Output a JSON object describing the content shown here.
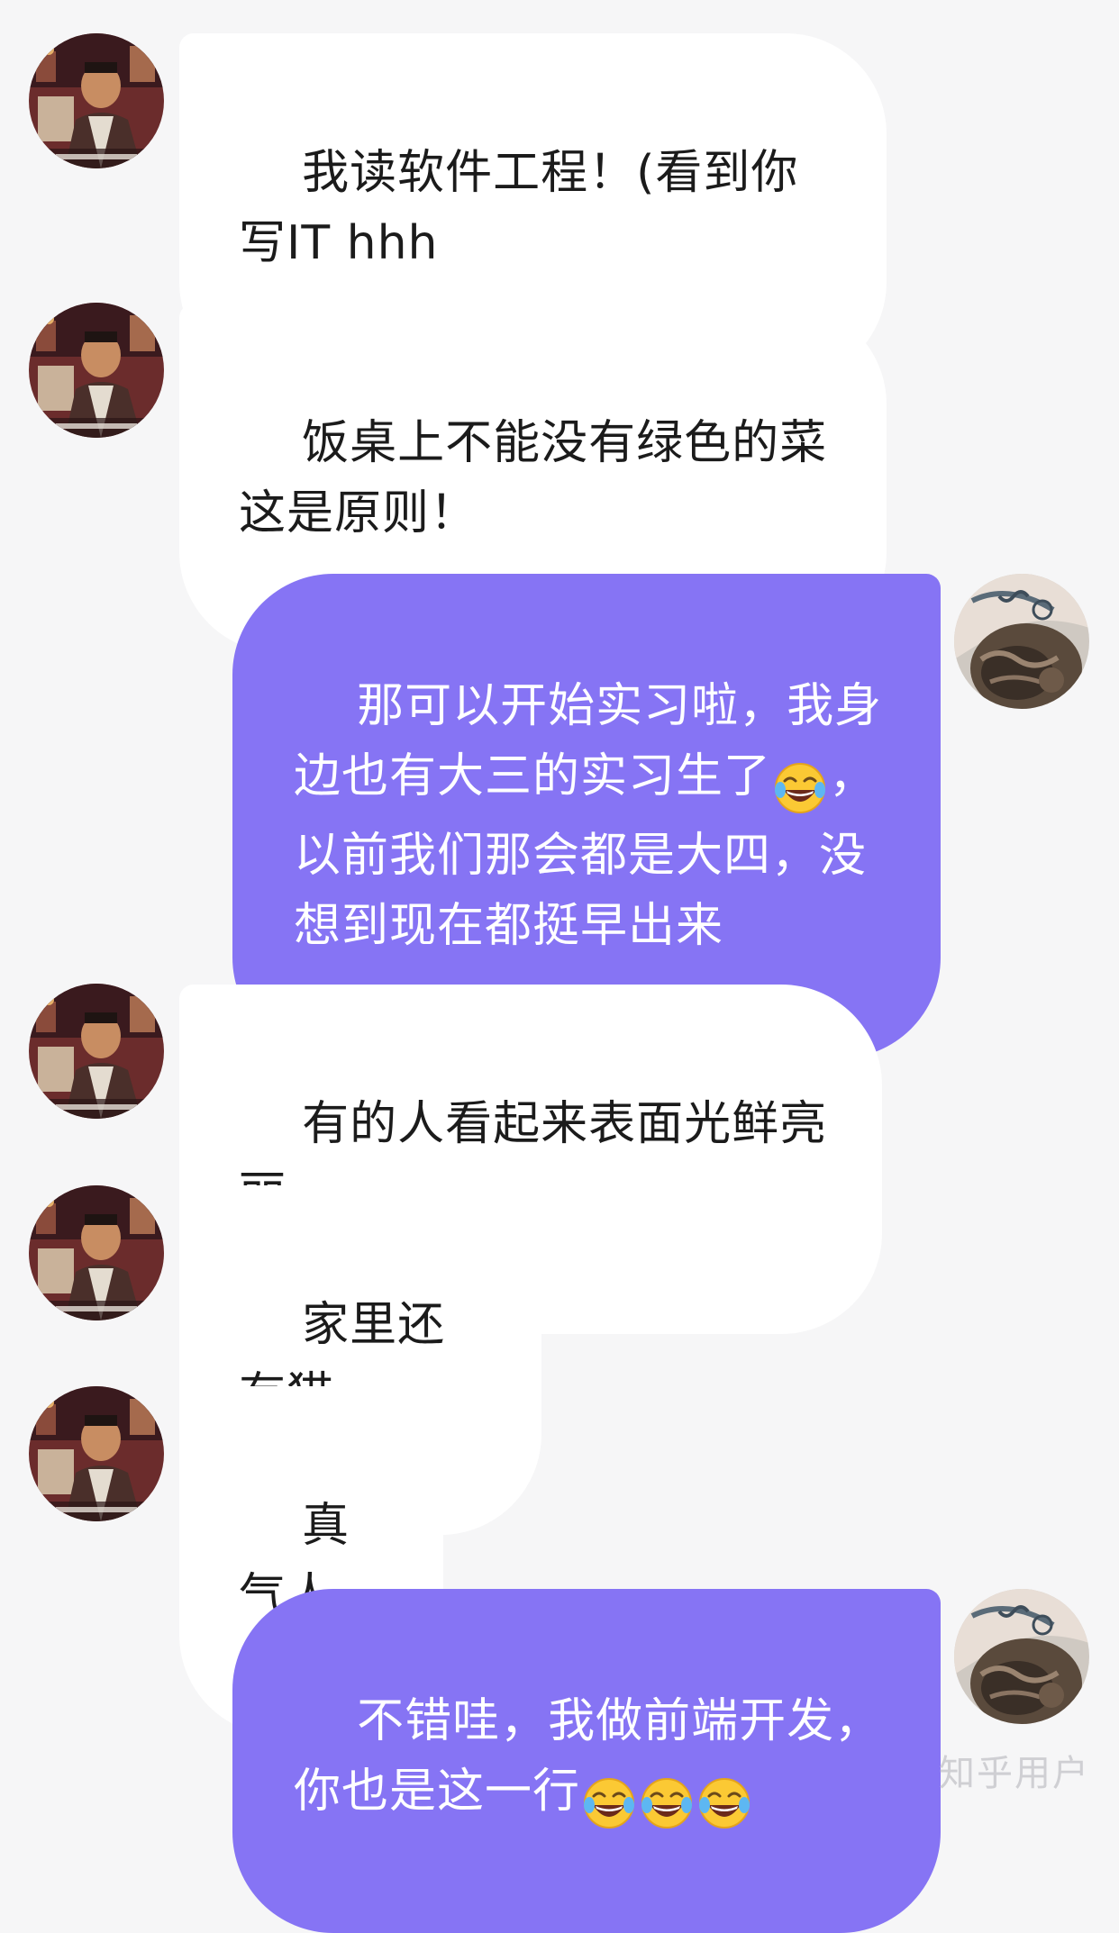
{
  "messages": [
    {
      "sender": "other",
      "avatar_icon": "avatar-other-icon",
      "text": "我读软件工程！(看到你写IT hhh"
    },
    {
      "sender": "other",
      "avatar_icon": "avatar-other-icon",
      "text": "饭桌上不能没有绿色的菜 这是原则！"
    },
    {
      "sender": "me",
      "avatar_icon": "avatar-me-icon",
      "text_before": "那可以开始实习啦，我身边也有大三的实习生了",
      "emoji_count": 1,
      "emoji_icon": "tears-of-joy-emoji-icon",
      "text_after": "，以前我们那会都是大四，没想到现在都挺早出来"
    },
    {
      "sender": "other",
      "avatar_icon": "avatar-other-icon",
      "text": "有的人看起来表面光鲜亮丽"
    },
    {
      "sender": "other",
      "avatar_icon": "avatar-other-icon",
      "text": "家里还有猫"
    },
    {
      "sender": "other",
      "avatar_icon": "avatar-other-icon",
      "text": "真气人"
    },
    {
      "sender": "me",
      "avatar_icon": "avatar-me-icon",
      "text_before": "不错哇，我做前端开发，你也是这一行",
      "emoji_count": 3,
      "emoji_icon": "tears-of-joy-emoji-icon",
      "text_after": ""
    }
  ],
  "watermark": "知乎用户",
  "colors": {
    "background": "#f6f6f7",
    "incoming_bubble": "#ffffff",
    "outgoing_bubble": "#8674f4",
    "incoming_text": "#1b1b1b",
    "outgoing_text": "#ffffff"
  }
}
